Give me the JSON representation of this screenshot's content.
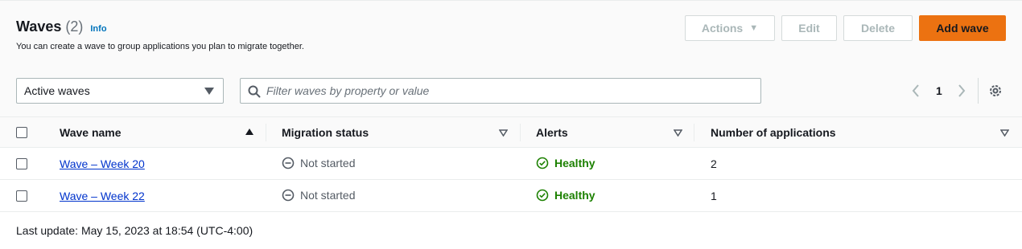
{
  "header": {
    "title": "Waves",
    "count": "(2)",
    "info": "Info",
    "description": "You can create a wave to group applications you plan to migrate together."
  },
  "buttons": {
    "actions": "Actions",
    "edit": "Edit",
    "delete": "Delete",
    "add": "Add wave"
  },
  "filter": {
    "selected": "Active waves",
    "search_placeholder": "Filter waves by property or value"
  },
  "pagination": {
    "current_page": "1"
  },
  "table": {
    "columns": [
      "Wave name",
      "Migration status",
      "Alerts",
      "Number of applications"
    ],
    "rows": [
      {
        "name": "Wave – Week 20",
        "status": "Not started",
        "alert": "Healthy",
        "apps": "2"
      },
      {
        "name": "Wave – Week 22",
        "status": "Not started",
        "alert": "Healthy",
        "apps": "1"
      }
    ]
  },
  "footer": {
    "last_update": "Last update: May 15, 2023 at 18:54 (UTC-4:00)"
  },
  "colors": {
    "accent": "#ec7211",
    "link": "#0033cc",
    "healthy": "#1d8102",
    "info": "#0073bb"
  }
}
